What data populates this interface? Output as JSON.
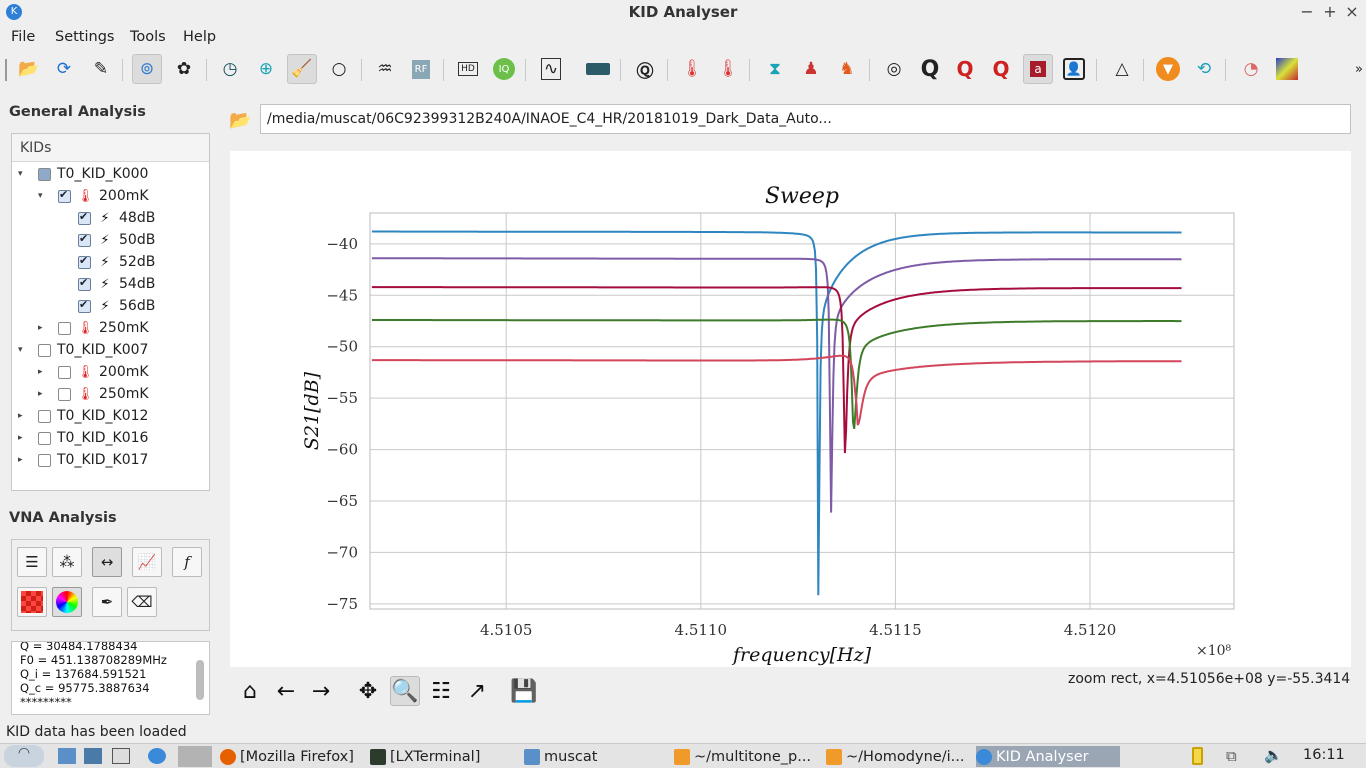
{
  "window": {
    "title": "KID Analyser"
  },
  "menu": [
    "File",
    "Settings",
    "Tools",
    "Help"
  ],
  "general_analysis": {
    "title": "General Analysis",
    "tree_header": "KIDs",
    "rows": [
      {
        "label": "T0_KID_K000",
        "level": 0,
        "expanded": true,
        "check": "partial",
        "icon": "none"
      },
      {
        "label": "200mK",
        "level": 1,
        "expanded": true,
        "check": "checked",
        "icon": "thermometer-icon"
      },
      {
        "label": "48dB",
        "level": 2,
        "check": "checked",
        "icon": "bolt-icon"
      },
      {
        "label": "50dB",
        "level": 2,
        "check": "checked",
        "icon": "bolt-icon"
      },
      {
        "label": "52dB",
        "level": 2,
        "check": "checked",
        "icon": "bolt-icon"
      },
      {
        "label": "54dB",
        "level": 2,
        "check": "checked",
        "icon": "bolt-icon"
      },
      {
        "label": "56dB",
        "level": 2,
        "check": "checked",
        "icon": "bolt-icon"
      },
      {
        "label": "250mK",
        "level": 1,
        "expanded": false,
        "check": "unchecked",
        "icon": "thermometer-icon"
      },
      {
        "label": "T0_KID_K007",
        "level": 0,
        "expanded": true,
        "check": "unchecked",
        "icon": "none"
      },
      {
        "label": "200mK",
        "level": 1,
        "expanded": false,
        "check": "unchecked",
        "icon": "thermometer-icon"
      },
      {
        "label": "250mK",
        "level": 1,
        "expanded": false,
        "check": "unchecked",
        "icon": "thermometer-icon"
      },
      {
        "label": "T0_KID_K012",
        "level": 0,
        "expanded": false,
        "check": "unchecked",
        "icon": "none"
      },
      {
        "label": "T0_KID_K016",
        "level": 0,
        "expanded": false,
        "check": "unchecked",
        "icon": "none"
      },
      {
        "label": "T0_KID_K017",
        "level": 0,
        "expanded": false,
        "check": "unchecked",
        "icon": "none"
      }
    ]
  },
  "vna_analysis": {
    "title": "VNA Analysis",
    "log_lines": [
      "Q = 30484.1788434",
      "F0 = 451.138708289MHz",
      "Q_i = 137684.591521",
      "Q_c = 95775.3887634",
      "*********"
    ]
  },
  "path": "/media/muscat/06C92399312B240A/INAOE_C4_HR/20181019_Dark_Data_Auto...",
  "nav_status": "zoom rect, x=4.51056e+08  y=-55.3414",
  "status_bar": "KID data has been loaded",
  "taskbar": {
    "tasks": [
      "[Mozilla Firefox]",
      "[LXTerminal]",
      "muscat",
      "~/multitone_p...",
      "~/Homodyne/i...",
      "KID Analyser"
    ],
    "clock": "16:11"
  },
  "chart_data": {
    "type": "line",
    "title": "Sweep",
    "xlabel": "frequency[Hz]",
    "ylabel": "S21[dB]",
    "x_multiplier_label": "×10⁸",
    "xlim": [
      4.51015,
      4.51237
    ],
    "ylim": [
      -75.5,
      -37.0
    ],
    "x_ticks": [
      4.5105,
      4.511,
      4.5115,
      4.512
    ],
    "x_tick_labels": [
      "4.5105",
      "4.5110",
      "4.5115",
      "4.5120"
    ],
    "y_ticks": [
      -40,
      -45,
      -50,
      -55,
      -60,
      -65,
      -70,
      -75
    ],
    "y_tick_labels": [
      "−40",
      "−45",
      "−50",
      "−55",
      "−60",
      "−65",
      "−70",
      "−75"
    ],
    "grid": true,
    "series": [
      {
        "color": "#2e86c1",
        "base_left": -38.8,
        "base_right": -38.9,
        "near_peak": -39.1,
        "f0": 4.511302,
        "dip": -73.8,
        "width": 3.5e-06,
        "recover": 8e-05
      },
      {
        "color": "#7d5ba6",
        "base_left": -41.4,
        "base_right": -41.5,
        "near_peak": -41.3,
        "f0": 4.511334,
        "dip": -66.2,
        "width": 5e-06,
        "recover": 0.0001
      },
      {
        "color": "#a50d3c",
        "base_left": -44.2,
        "base_right": -44.3,
        "near_peak": -43.9,
        "f0": 4.51137,
        "dip": -60.3,
        "width": 7e-06,
        "recover": 0.00011
      },
      {
        "color": "#3d7a2a",
        "base_left": -47.4,
        "base_right": -47.5,
        "near_peak": -46.9,
        "f0": 4.511392,
        "dip": -58.2,
        "width": 1e-05,
        "recover": 0.00013
      },
      {
        "color": "#d2455a",
        "base_left": -51.3,
        "base_right": -51.4,
        "near_peak": -49.8,
        "f0": 4.511402,
        "dip": -57.6,
        "width": 1.6e-05,
        "recover": 0.00017
      }
    ]
  }
}
